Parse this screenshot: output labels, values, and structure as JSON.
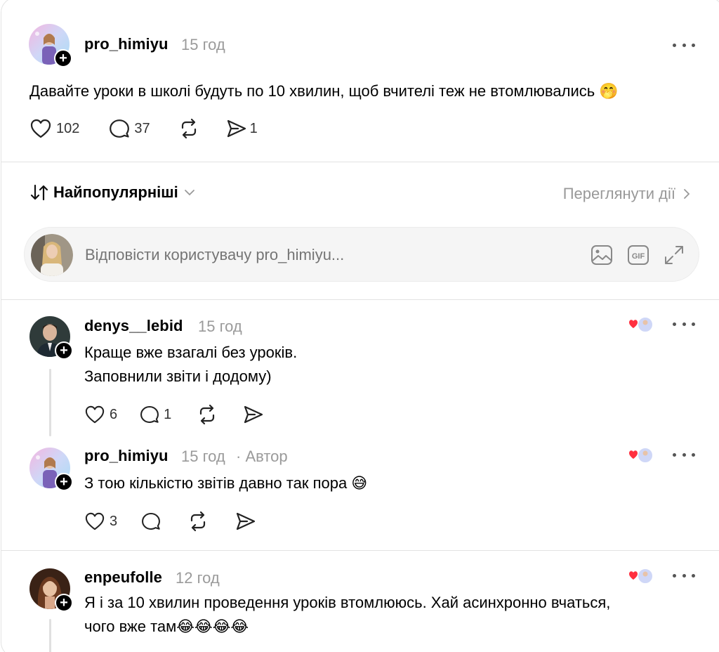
{
  "post": {
    "username": "pro_himiyu",
    "time": "15 год",
    "text": "Давайте уроки в школі будуть по 10 хвилин, щоб вчителі теж не втомлювались 🤭",
    "likes": "102",
    "replies": "37",
    "shares": "1"
  },
  "sort": {
    "label": "Найпопулярніші",
    "view_activity": "Переглянути дії"
  },
  "reply_box": {
    "placeholder": "Відповісти користувачу pro_himiyu..."
  },
  "comments": [
    {
      "username": "denys__lebid",
      "time": "15 год",
      "lines": [
        "Краще вже взагалі без уроків.",
        "Заповнили звіти і додому)"
      ],
      "likes": "6",
      "replies": "1"
    },
    {
      "username": "pro_himiyu",
      "time": "15 год",
      "author_tag": "· Автор",
      "lines": [
        "З тою кількістю звітів давно так пора 😅"
      ],
      "likes": "3"
    },
    {
      "username": "enpeufolle",
      "time": "12 год",
      "lines": [
        "Я і за 10 хвилин проведення уроків втомлююсь. Хай асинхронно вчаться,",
        "чого вже там😂😂😂😂"
      ]
    }
  ]
}
